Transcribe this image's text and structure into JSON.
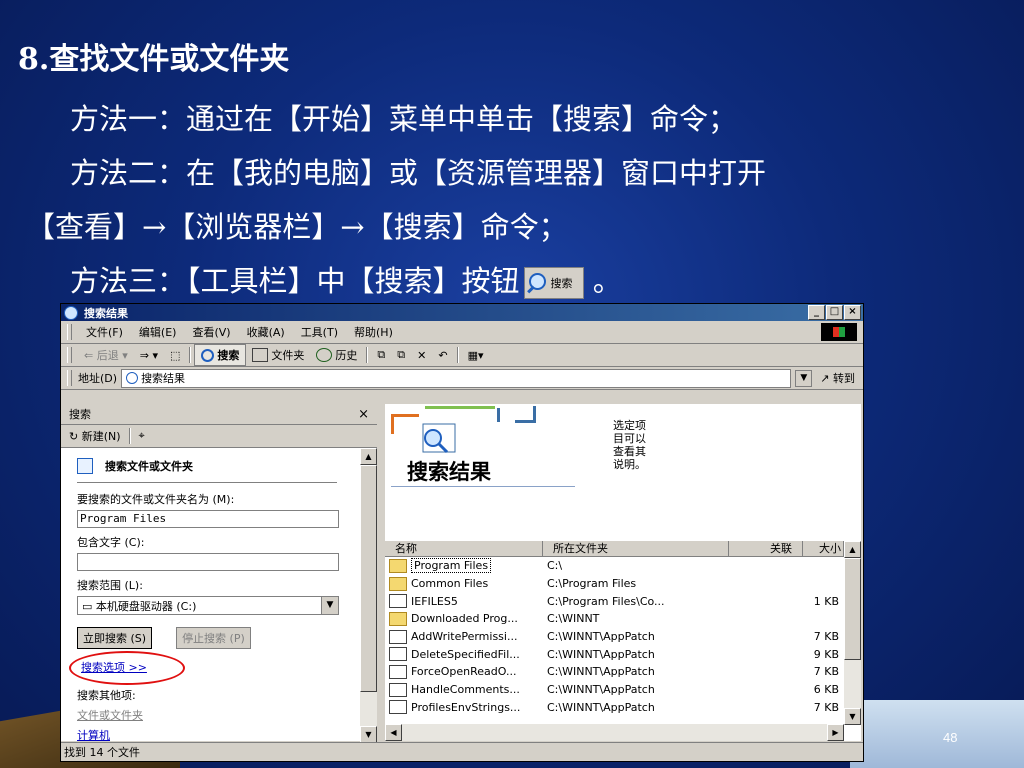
{
  "slide": {
    "title": "8.查找文件或文件夹",
    "line1": "方法一：通过在【开始】菜单中单击【搜索】命令；",
    "line2": "方法二：在【我的电脑】或【资源管理器】窗口中打开",
    "line3": "【查看】→【浏览器栏】→【搜索】命令；",
    "line4_a": "方法三：【工具栏】中【搜索】按钮",
    "line4_b": " 。",
    "inline_button_label": "搜索",
    "page_number": "48"
  },
  "window": {
    "title": "搜索结果",
    "caption_buttons": [
      "_",
      "□",
      "×"
    ],
    "menu": [
      "文件(F)",
      "编辑(E)",
      "查看(V)",
      "收藏(A)",
      "工具(T)",
      "帮助(H)"
    ],
    "toolbar": {
      "back": "后退",
      "search": "搜索",
      "folders": "文件夹",
      "history": "历史"
    },
    "address": {
      "label": "地址(D)",
      "value": "搜索结果",
      "go": "转到"
    },
    "search_pane": {
      "header": "搜索",
      "new_button": "新建(N)",
      "section_title": "搜索文件或文件夹",
      "name_label": "要搜索的文件或文件夹名为 (M):",
      "name_value": "Program Files",
      "contains_label": "包含文字 (C):",
      "contains_value": "",
      "scope_label": "搜索范围 (L):",
      "scope_value": "本机硬盘驱动器 (C:)",
      "search_now": "立即搜索 (S)",
      "stop_search": "停止搜索 (P)",
      "options_link": "搜索选项 >>",
      "other_label": "搜索其他项:",
      "other_link1": "文件或文件夹",
      "other_link2": "计算机"
    },
    "results": {
      "banner_title": "搜索结果",
      "banner_note": "选定项目可以查看其说明。",
      "columns": [
        "名称",
        "所在文件夹",
        "关联",
        "大小"
      ],
      "rows": [
        {
          "name": "Program Files",
          "folder": "C:\\",
          "rel": "",
          "size": "",
          "type": "folder"
        },
        {
          "name": "Common Files",
          "folder": "C:\\Program Files",
          "rel": "",
          "size": "",
          "type": "folder"
        },
        {
          "name": "IEFILES5",
          "folder": "C:\\Program Files\\Co...",
          "rel": "",
          "size": "1 KB",
          "type": "file"
        },
        {
          "name": "Downloaded Prog...",
          "folder": "C:\\WINNT",
          "rel": "",
          "size": "",
          "type": "folder"
        },
        {
          "name": "AddWritePermissi...",
          "folder": "C:\\WINNT\\AppPatch",
          "rel": "",
          "size": "7 KB",
          "type": "file"
        },
        {
          "name": "DeleteSpecifiedFil...",
          "folder": "C:\\WINNT\\AppPatch",
          "rel": "",
          "size": "9 KB",
          "type": "file"
        },
        {
          "name": "ForceOpenReadO...",
          "folder": "C:\\WINNT\\AppPatch",
          "rel": "",
          "size": "7 KB",
          "type": "file"
        },
        {
          "name": "HandleComments...",
          "folder": "C:\\WINNT\\AppPatch",
          "rel": "",
          "size": "6 KB",
          "type": "file"
        },
        {
          "name": "ProfilesEnvStrings...",
          "folder": "C:\\WINNT\\AppPatch",
          "rel": "",
          "size": "7 KB",
          "type": "file"
        }
      ]
    },
    "status": "找到 14 个文件"
  }
}
